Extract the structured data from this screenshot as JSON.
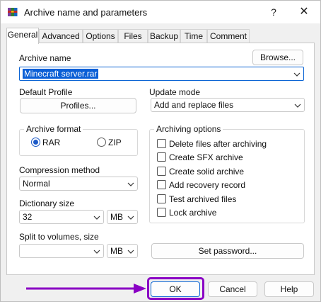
{
  "window": {
    "title": "Archive name and parameters",
    "help_glyph": "?",
    "close_glyph": "✕",
    "icon": "winrar-books-icon"
  },
  "tabs": [
    {
      "label": "General",
      "active": true
    },
    {
      "label": "Advanced"
    },
    {
      "label": "Options"
    },
    {
      "label": "Files"
    },
    {
      "label": "Backup"
    },
    {
      "label": "Time"
    },
    {
      "label": "Comment"
    }
  ],
  "archive_name": {
    "label": "Archive name",
    "value": "Minecraft server.rar",
    "browse_label": "Browse..."
  },
  "default_profile": {
    "label": "Default Profile",
    "button_label": "Profiles..."
  },
  "update_mode": {
    "label": "Update mode",
    "value": "Add and replace files"
  },
  "archive_format": {
    "label": "Archive format",
    "options": [
      {
        "label": "RAR",
        "selected": true
      },
      {
        "label": "ZIP",
        "selected": false
      }
    ]
  },
  "compression_method": {
    "label": "Compression method",
    "value": "Normal"
  },
  "dictionary_size": {
    "label": "Dictionary size",
    "value": "32",
    "unit": "MB"
  },
  "split_volumes": {
    "label": "Split to volumes, size",
    "value": "",
    "unit": "MB"
  },
  "archiving_options": {
    "label": "Archiving options",
    "items": [
      {
        "label": "Delete files after archiving",
        "checked": false
      },
      {
        "label": "Create SFX archive",
        "checked": false
      },
      {
        "label": "Create solid archive",
        "checked": false
      },
      {
        "label": "Add recovery record",
        "checked": false
      },
      {
        "label": "Test archived files",
        "checked": false
      },
      {
        "label": "Lock archive",
        "checked": false
      }
    ]
  },
  "set_password_label": "Set password...",
  "buttons": {
    "ok": "OK",
    "cancel": "Cancel",
    "help": "Help"
  },
  "colors": {
    "highlight": "#8a00c4",
    "selection": "#0a5fd6",
    "accent": "#1a58c7"
  }
}
